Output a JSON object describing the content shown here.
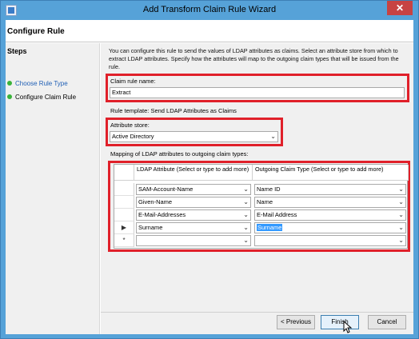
{
  "window": {
    "title": "Add Transform Claim Rule Wizard",
    "close_glyph": "✕"
  },
  "header": {
    "title": "Configure Rule"
  },
  "steps": {
    "heading": "Steps",
    "items": [
      {
        "label": "Choose Rule Type"
      },
      {
        "label": "Configure Claim Rule"
      }
    ]
  },
  "main": {
    "description": "You can configure this rule to send the values of LDAP attributes as claims. Select an attribute store from which to extract LDAP attributes. Specify how the attributes will map to the outgoing claim types that will be issued from the rule.",
    "claim_rule_name_label": "Claim rule name:",
    "claim_rule_name_value": "Extract",
    "rule_template": "Rule template: Send LDAP Attributes as Claims",
    "attribute_store_label": "Attribute store:",
    "attribute_store_value": "Active Directory",
    "mapping_label": "Mapping of LDAP attributes to outgoing claim types:"
  },
  "grid": {
    "col1_header": "LDAP Attribute (Select or type to add more)",
    "col2_header": "Outgoing Claim Type (Select or type to add more)",
    "rows": [
      {
        "marker": "",
        "ldap": "SAM-Account-Name",
        "claim": "Name ID"
      },
      {
        "marker": "",
        "ldap": "Given-Name",
        "claim": "Name"
      },
      {
        "marker": "",
        "ldap": "E-Mail-Addresses",
        "claim": "E-Mail Address"
      },
      {
        "marker": "▶",
        "ldap": "Surname",
        "claim": "Surname"
      },
      {
        "marker": "*",
        "ldap": "",
        "claim": ""
      }
    ]
  },
  "buttons": {
    "previous": "< Previous",
    "finish": "Finish",
    "cancel": "Cancel"
  },
  "colors": {
    "titlebar": "#56a2d8",
    "highlight_box": "#e0202a",
    "selection": "#3399ff"
  }
}
